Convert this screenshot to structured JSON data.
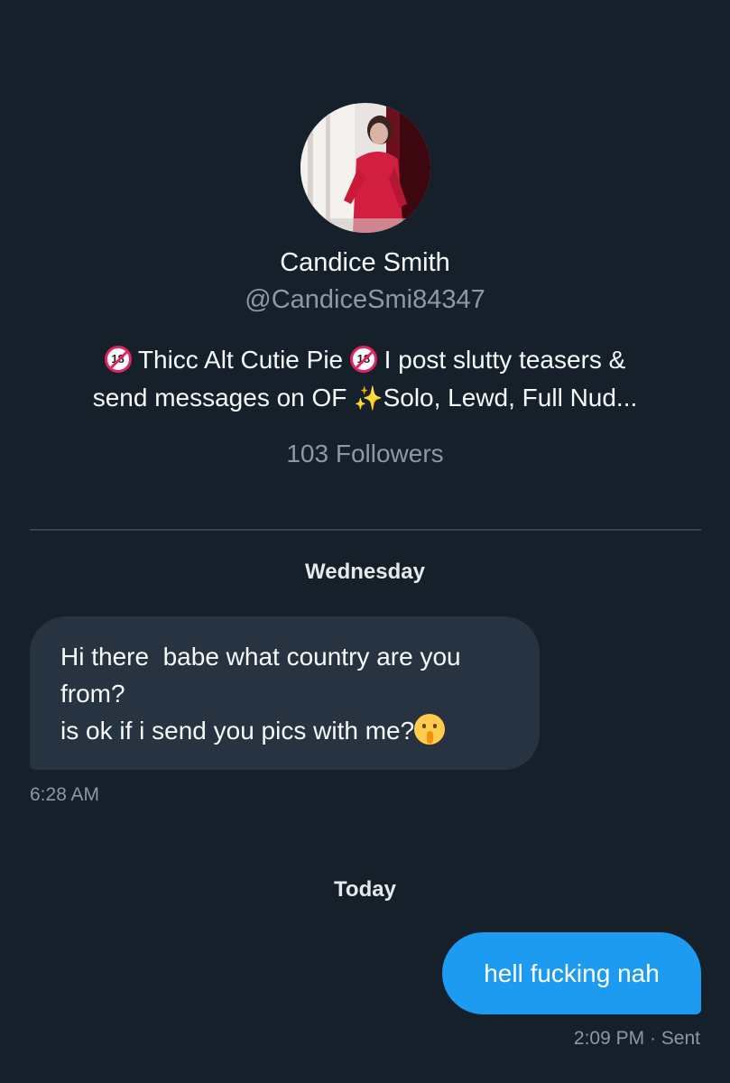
{
  "profile": {
    "avatar_icon": "profile-photo",
    "display_name": "Candice Smith",
    "handle": "@CandiceSmi84347",
    "bio": {
      "line1_part1": " Thicc Alt Cutie Pie ",
      "line1_part2": " I post slutty teasers &",
      "line2_part1": "send messages on OF ",
      "line2_part2": "Solo, Lewd, Full Nud...",
      "badge_icon": "no-one-under-eighteen-emoji",
      "badge_text": "18",
      "sparkles_icon": "sparkles-emoji",
      "sparkles_glyph": "✨"
    },
    "followers": "103 Followers"
  },
  "conversation": {
    "day_labels": [
      "Wednesday",
      "Today"
    ],
    "messages": [
      {
        "direction": "received",
        "lines": [
          "Hi there  babe what country are you",
          "from?",
          "is ok if i send you pics with me?"
        ],
        "emoji_icon": "shushing-face-emoji",
        "time": "6:28 AM"
      },
      {
        "direction": "sent",
        "text": "hell fucking nah",
        "time": "2:09 PM · Sent"
      }
    ]
  },
  "colors": {
    "background": "#15202b",
    "received_bubble": "#273340",
    "sent_bubble": "#1d9bf0",
    "secondary_text": "#8b98a5",
    "divider": "#38444d"
  }
}
